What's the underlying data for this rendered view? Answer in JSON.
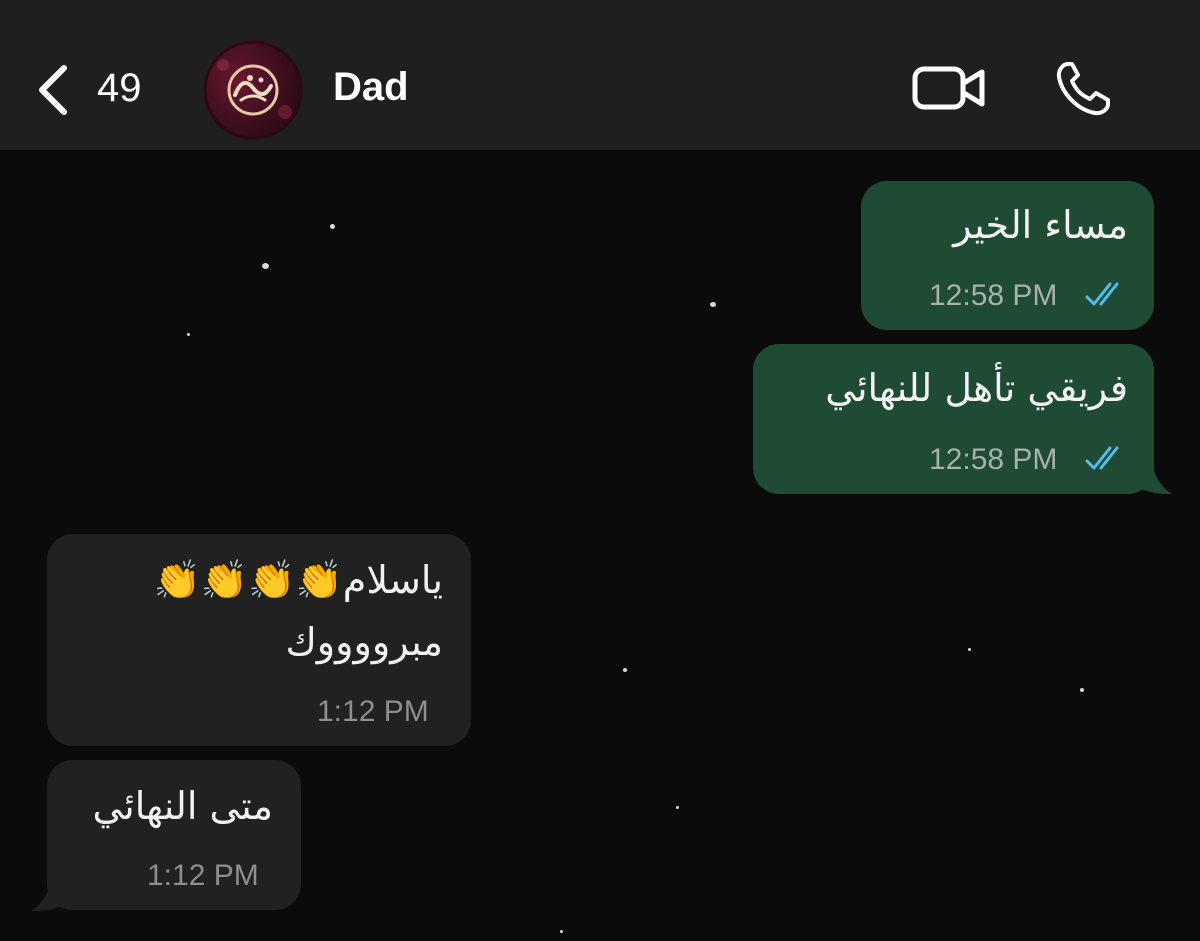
{
  "header": {
    "back_count": "49",
    "contact_name": "Dad"
  },
  "messages": [
    {
      "direction": "outgoing",
      "text": "مساء الخير",
      "time": "12:58 PM",
      "status": "read"
    },
    {
      "direction": "outgoing",
      "text": "فريقي تأهل للنهائي",
      "time": "12:58 PM",
      "status": "read"
    },
    {
      "direction": "incoming",
      "line1": "ياسلام👏👏👏👏",
      "line2": "مبرووووك",
      "time": "1:12 PM"
    },
    {
      "direction": "incoming",
      "text": "متى النهائي",
      "time": "1:12 PM"
    }
  ],
  "colors": {
    "outgoing_bubble": "#1f4b34",
    "incoming_bubble": "#212122",
    "read_ticks": "#53bdeb",
    "header_bg": "#1f1f20"
  },
  "icons": [
    "chevron-left-icon",
    "video-camera-icon",
    "phone-icon"
  ]
}
